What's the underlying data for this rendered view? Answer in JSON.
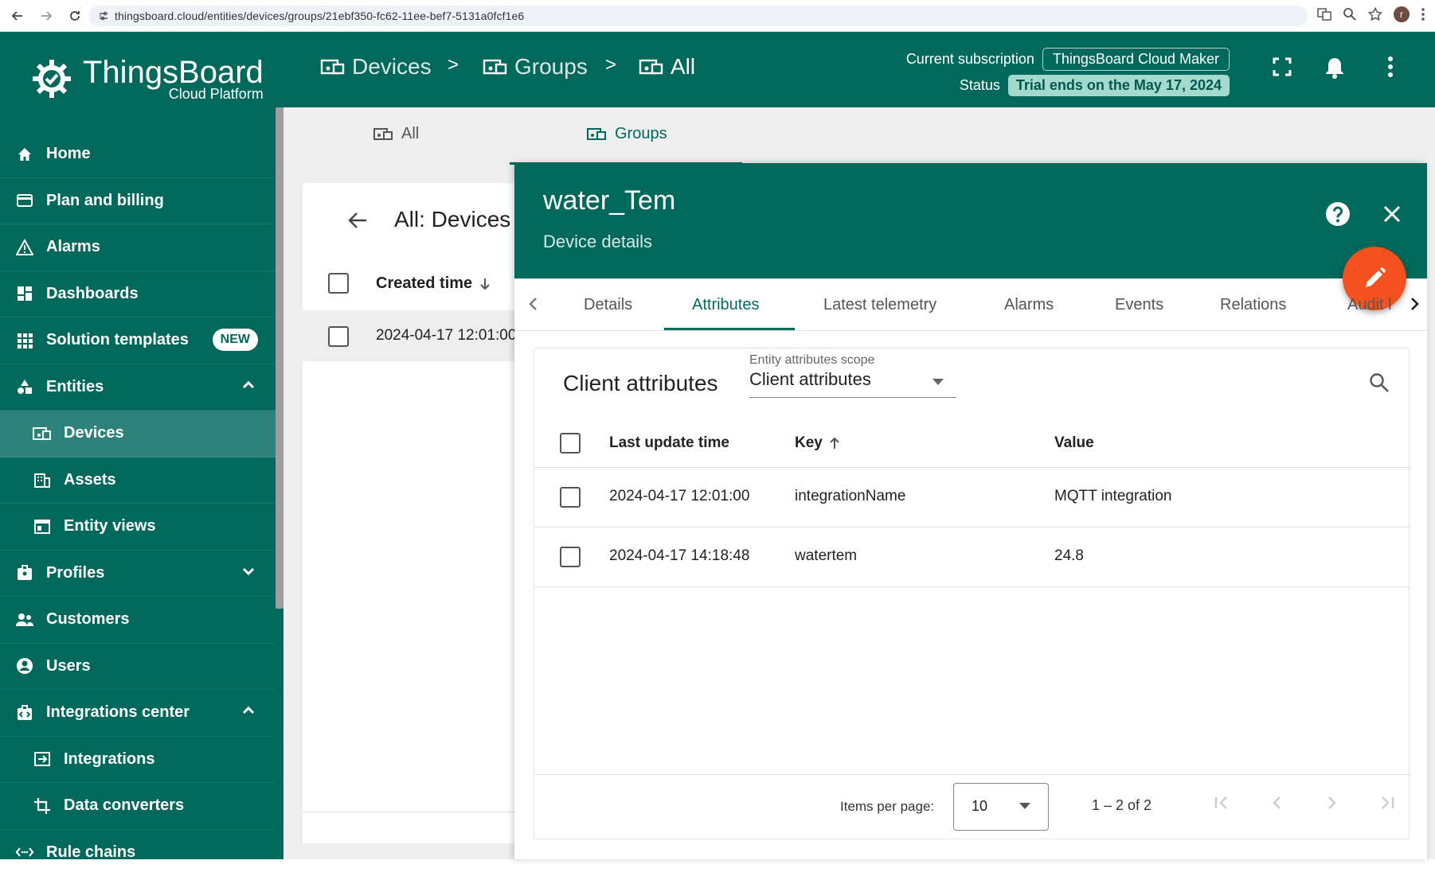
{
  "browser": {
    "url": "thingsboard.cloud/entities/devices/groups/21ebf350-fc62-11ee-bef7-5131a0fcf1e6",
    "profile_initial": "r"
  },
  "logo": {
    "title": "ThingsBoard",
    "subtitle": "Cloud Platform"
  },
  "sidebar": {
    "items": [
      {
        "label": "Home",
        "icon": "home-icon"
      },
      {
        "label": "Plan and billing",
        "icon": "billing-icon"
      },
      {
        "label": "Alarms",
        "icon": "alarm-icon"
      },
      {
        "label": "Dashboards",
        "icon": "dashboard-icon"
      },
      {
        "label": "Solution templates",
        "icon": "apps-icon",
        "badge": "NEW"
      },
      {
        "label": "Entities",
        "icon": "entities-icon"
      },
      {
        "label": "Devices",
        "icon": "devices-icon"
      },
      {
        "label": "Assets",
        "icon": "assets-icon"
      },
      {
        "label": "Entity views",
        "icon": "entity-views-icon"
      },
      {
        "label": "Profiles",
        "icon": "profiles-icon"
      },
      {
        "label": "Customers",
        "icon": "customers-icon"
      },
      {
        "label": "Users",
        "icon": "users-icon"
      },
      {
        "label": "Integrations center",
        "icon": "integrations-center-icon"
      },
      {
        "label": "Integrations",
        "icon": "integrations-icon"
      },
      {
        "label": "Data converters",
        "icon": "converters-icon"
      },
      {
        "label": "Rule chains",
        "icon": "rule-chains-icon"
      }
    ]
  },
  "header": {
    "breadcrumbs": [
      "Devices",
      "Groups",
      "All"
    ],
    "separator": ">",
    "subscription_label": "Current subscription",
    "subscription_value": "ThingsBoard Cloud Maker",
    "status_label": "Status",
    "status_value": "Trial ends on the May 17, 2024"
  },
  "page_tabs": [
    "All",
    "Groups"
  ],
  "list": {
    "title": "All: Devices",
    "column": "Created time",
    "rows": [
      "2024-04-17 12:01:00"
    ]
  },
  "drawer": {
    "title": "water_Tem",
    "subtitle": "Device details",
    "tabs": [
      "Details",
      "Attributes",
      "Latest telemetry",
      "Alarms",
      "Events",
      "Relations",
      "Audit l"
    ],
    "active_tab": "Attributes",
    "attributes": {
      "title": "Client attributes",
      "scope_label": "Entity attributes scope",
      "scope_value": "Client attributes",
      "columns": [
        "Last update time",
        "Key",
        "Value"
      ],
      "rows": [
        {
          "time": "2024-04-17 12:01:00",
          "key": "integrationName",
          "value": "MQTT integration"
        },
        {
          "time": "2024-04-17 14:18:48",
          "key": "watertem",
          "value": "24.8"
        }
      ],
      "items_per_page_label": "Items per page:",
      "items_per_page": "10",
      "range": "1 – 2 of 2"
    }
  },
  "colors": {
    "primary": "#01695c",
    "accent": "#f4511e",
    "status_bg": "#a5d9cd"
  }
}
